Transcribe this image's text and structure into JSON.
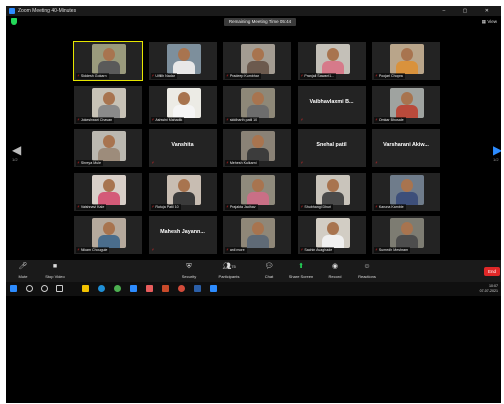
{
  "window": {
    "title": "Zoom Meeting 40-Minutes",
    "controls": "–  ▢  ✕"
  },
  "topbar": {
    "timer": "Remaining Meeting Time 05:44",
    "view_label": "View"
  },
  "nav": {
    "left_page": "1/2",
    "right_page": "1/2"
  },
  "participants": [
    {
      "name": "Siddesh Gokarn",
      "video": true,
      "active": true,
      "bg": "#9a9a7c",
      "shirt": "#5a5a5a"
    },
    {
      "name": "Ulfillh Nadar",
      "video": true,
      "bg": "#7d8f9c",
      "shirt": "#e8e8e8"
    },
    {
      "name": "Pradeep Kumbhar",
      "video": true,
      "bg": "#a39c92",
      "shirt": "#6c5a4e"
    },
    {
      "name": "Pranjali Sawant1...",
      "video": true,
      "bg": "#c4c0b8",
      "shirt": "#d67a8a"
    },
    {
      "name": "Poojari Chopra",
      "video": true,
      "bg": "#b9a58a",
      "shirt": "#d9923c"
    },
    {
      "name": "Jokeshwari Chavan",
      "video": true,
      "bg": "#c7c2b6",
      "shirt": "#8a8a8a"
    },
    {
      "name": "Ashwini Mahadik",
      "video": true,
      "bg": "#ecebe5",
      "shirt": "#f5f5f5"
    },
    {
      "name": "siddharth patil 10",
      "video": true,
      "bg": "#8e8878",
      "shirt": "#6d6d6d"
    },
    {
      "name": "",
      "video": false,
      "big": "Vaibhavlaxmi  B..."
    },
    {
      "name": "Omkar Bhosale",
      "video": true,
      "bg": "#9fa3a0",
      "shirt": "#b94a3b"
    },
    {
      "name": "Shreya Mule",
      "video": true,
      "bg": "#bbb8b0",
      "shirt": "#9d8c7b"
    },
    {
      "name": "",
      "video": false,
      "big": "Vanshita"
    },
    {
      "name": "Mehesh Kulkarni",
      "video": true,
      "bg": "#8a8276",
      "shirt": "#3c3c3c"
    },
    {
      "name": "",
      "video": false,
      "big": "Snehal patil"
    },
    {
      "name": "",
      "video": false,
      "big": "Varsharani  Akiw..."
    },
    {
      "name": "Vaishnavi Kale",
      "video": true,
      "bg": "#d8cfc8",
      "shirt": "#d45a78"
    },
    {
      "name": "Rutuja Patil 10",
      "video": true,
      "bg": "#c8bdb2",
      "shirt": "#3b3b3b"
    },
    {
      "name": "Prajakta Jadhav",
      "video": true,
      "bg": "#8f8a7c",
      "shirt": "#c96f86"
    },
    {
      "name": "Shubhangi Dhuri",
      "video": true,
      "bg": "#c9c4bb",
      "shirt": "#4a4a4a"
    },
    {
      "name": "Karuna Kamble",
      "video": true,
      "bg": "#6f7c8b",
      "shirt": "#3d4f7a"
    },
    {
      "name": "Nikam Chougule",
      "video": true,
      "bg": "#b5a99c",
      "shirt": "#4a6d8c"
    },
    {
      "name": "",
      "video": false,
      "big": "Mahesh  Jayann..."
    },
    {
      "name": "anil more",
      "video": true,
      "bg": "#8f8778",
      "shirt": "#5f6a76"
    },
    {
      "name": "Sachin Avaghade",
      "video": true,
      "bg": "#d2cdc4",
      "shirt": "#f0f0f0"
    },
    {
      "name": "Sumedh Meshram",
      "video": true,
      "bg": "#7d7c72",
      "shirt": "#4d4d4d"
    }
  ],
  "toolbar": {
    "mute": "Mute",
    "stop_video": "Stop Video",
    "security": "Security",
    "participants": "Participants",
    "participants_count": "75",
    "chat": "Chat",
    "share_screen": "Share Screen",
    "record": "Record",
    "reactions": "Reactions",
    "end": "End"
  },
  "taskbar": {
    "time": "10:07",
    "date": "07-07-2021"
  },
  "colors": {
    "accent": "#2d8cff",
    "share_green": "#23d959",
    "end_red": "#e02828",
    "active_speaker": "#e6e600"
  }
}
